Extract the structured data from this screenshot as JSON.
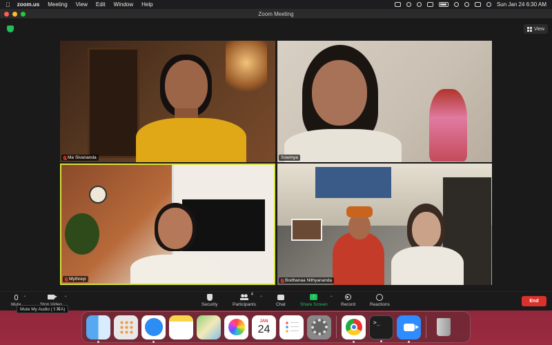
{
  "menubar": {
    "app_name": "zoom.us",
    "menus": [
      "Meeting",
      "View",
      "Edit",
      "Window",
      "Help"
    ],
    "clock": "Sun Jan 24  6:30 AM"
  },
  "window": {
    "title": "Zoom Meeting",
    "view_label": "View"
  },
  "participants": [
    {
      "name": "Ma Sivananda",
      "muted": true
    },
    {
      "name": "Sowmya",
      "muted": false
    },
    {
      "name": "Mythreyi",
      "muted": true,
      "active_speaker": true
    },
    {
      "name": "Bodhanaa Nithyananda",
      "muted": true
    }
  ],
  "controls": {
    "mute_label": "Mute",
    "video_label": "Stop Video",
    "security_label": "Security",
    "participants_label": "Participants",
    "participants_count": "4",
    "chat_label": "Chat",
    "share_label": "Share Screen",
    "record_label": "Record",
    "reactions_label": "Reactions",
    "end_label": "End",
    "tooltip": "Mute My Audio (⇧⌘A)"
  },
  "dock": {
    "calendar_month": "JAN",
    "calendar_day": "24",
    "terminal_prompt": ">_"
  },
  "colors": {
    "active_speaker_border": "#d8e33a",
    "share_green": "#1fbf5a",
    "end_red": "#d9312b",
    "zoom_blue": "#2d8cff"
  }
}
